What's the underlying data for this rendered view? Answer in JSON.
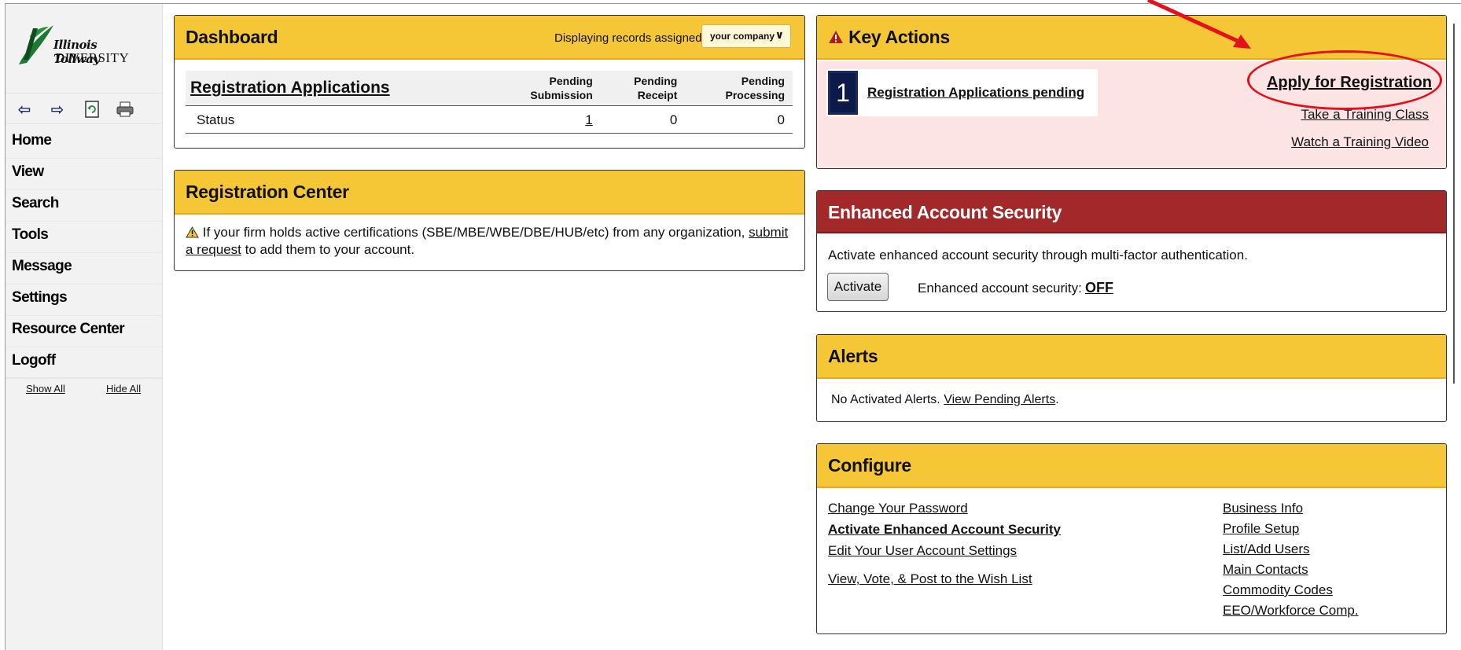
{
  "sidebar": {
    "logo_line1": "Illinois Tollway",
    "logo_line2": "DIVERSITY",
    "menu": [
      "Home",
      "View",
      "Search",
      "Tools",
      "Message",
      "Settings",
      "Resource Center",
      "Logoff"
    ],
    "show_all": "Show All",
    "hide_all": "Hide All"
  },
  "dashboard": {
    "title": "Dashboard",
    "displaying_label": "Displaying records assigned to",
    "assigned_select": "your company",
    "table_title": "Registration Applications",
    "columns": [
      {
        "line1": "Pending",
        "line2": "Submission"
      },
      {
        "line1": "Pending",
        "line2": "Receipt"
      },
      {
        "line1": "Pending",
        "line2": "Processing"
      }
    ],
    "row_label": "Status",
    "values": [
      "1",
      "0",
      "0"
    ]
  },
  "registration_center": {
    "title": "Registration Center",
    "text_before": "If your firm holds active certifications (SBE/MBE/WBE/DBE/HUB/etc) from any organization, ",
    "link": "submit a request",
    "text_after": " to add them to your account."
  },
  "key_actions": {
    "title": "Key Actions",
    "count": "1",
    "pending_link": "Registration Applications pending",
    "apply_link": "Apply for Registration",
    "training_class": "Take a Training Class",
    "training_video": "Watch a Training Video"
  },
  "security": {
    "title": "Enhanced Account Security",
    "description": "Activate enhanced account security through multi-factor authentication.",
    "activate_button": "Activate",
    "status_label": "Enhanced account security:",
    "status_value": "OFF"
  },
  "alerts": {
    "title": "Alerts",
    "text": "No Activated Alerts. ",
    "link": "View Pending Alerts",
    "suffix": "."
  },
  "configure": {
    "title": "Configure",
    "left_links": [
      "Change Your Password",
      "Activate Enhanced Account Security",
      "Edit Your User Account Settings",
      "View, Vote, & Post to the Wish List"
    ],
    "right_links": [
      "Business Info",
      "Profile Setup",
      "List/Add Users",
      "Main Contacts",
      "Commodity Codes",
      "EEO/Workforce Comp."
    ]
  },
  "colors": {
    "panel_header": "#f5c736",
    "security_header": "#a3282a",
    "key_actions_body": "#fde4e4",
    "annotation": "#e3121a"
  }
}
